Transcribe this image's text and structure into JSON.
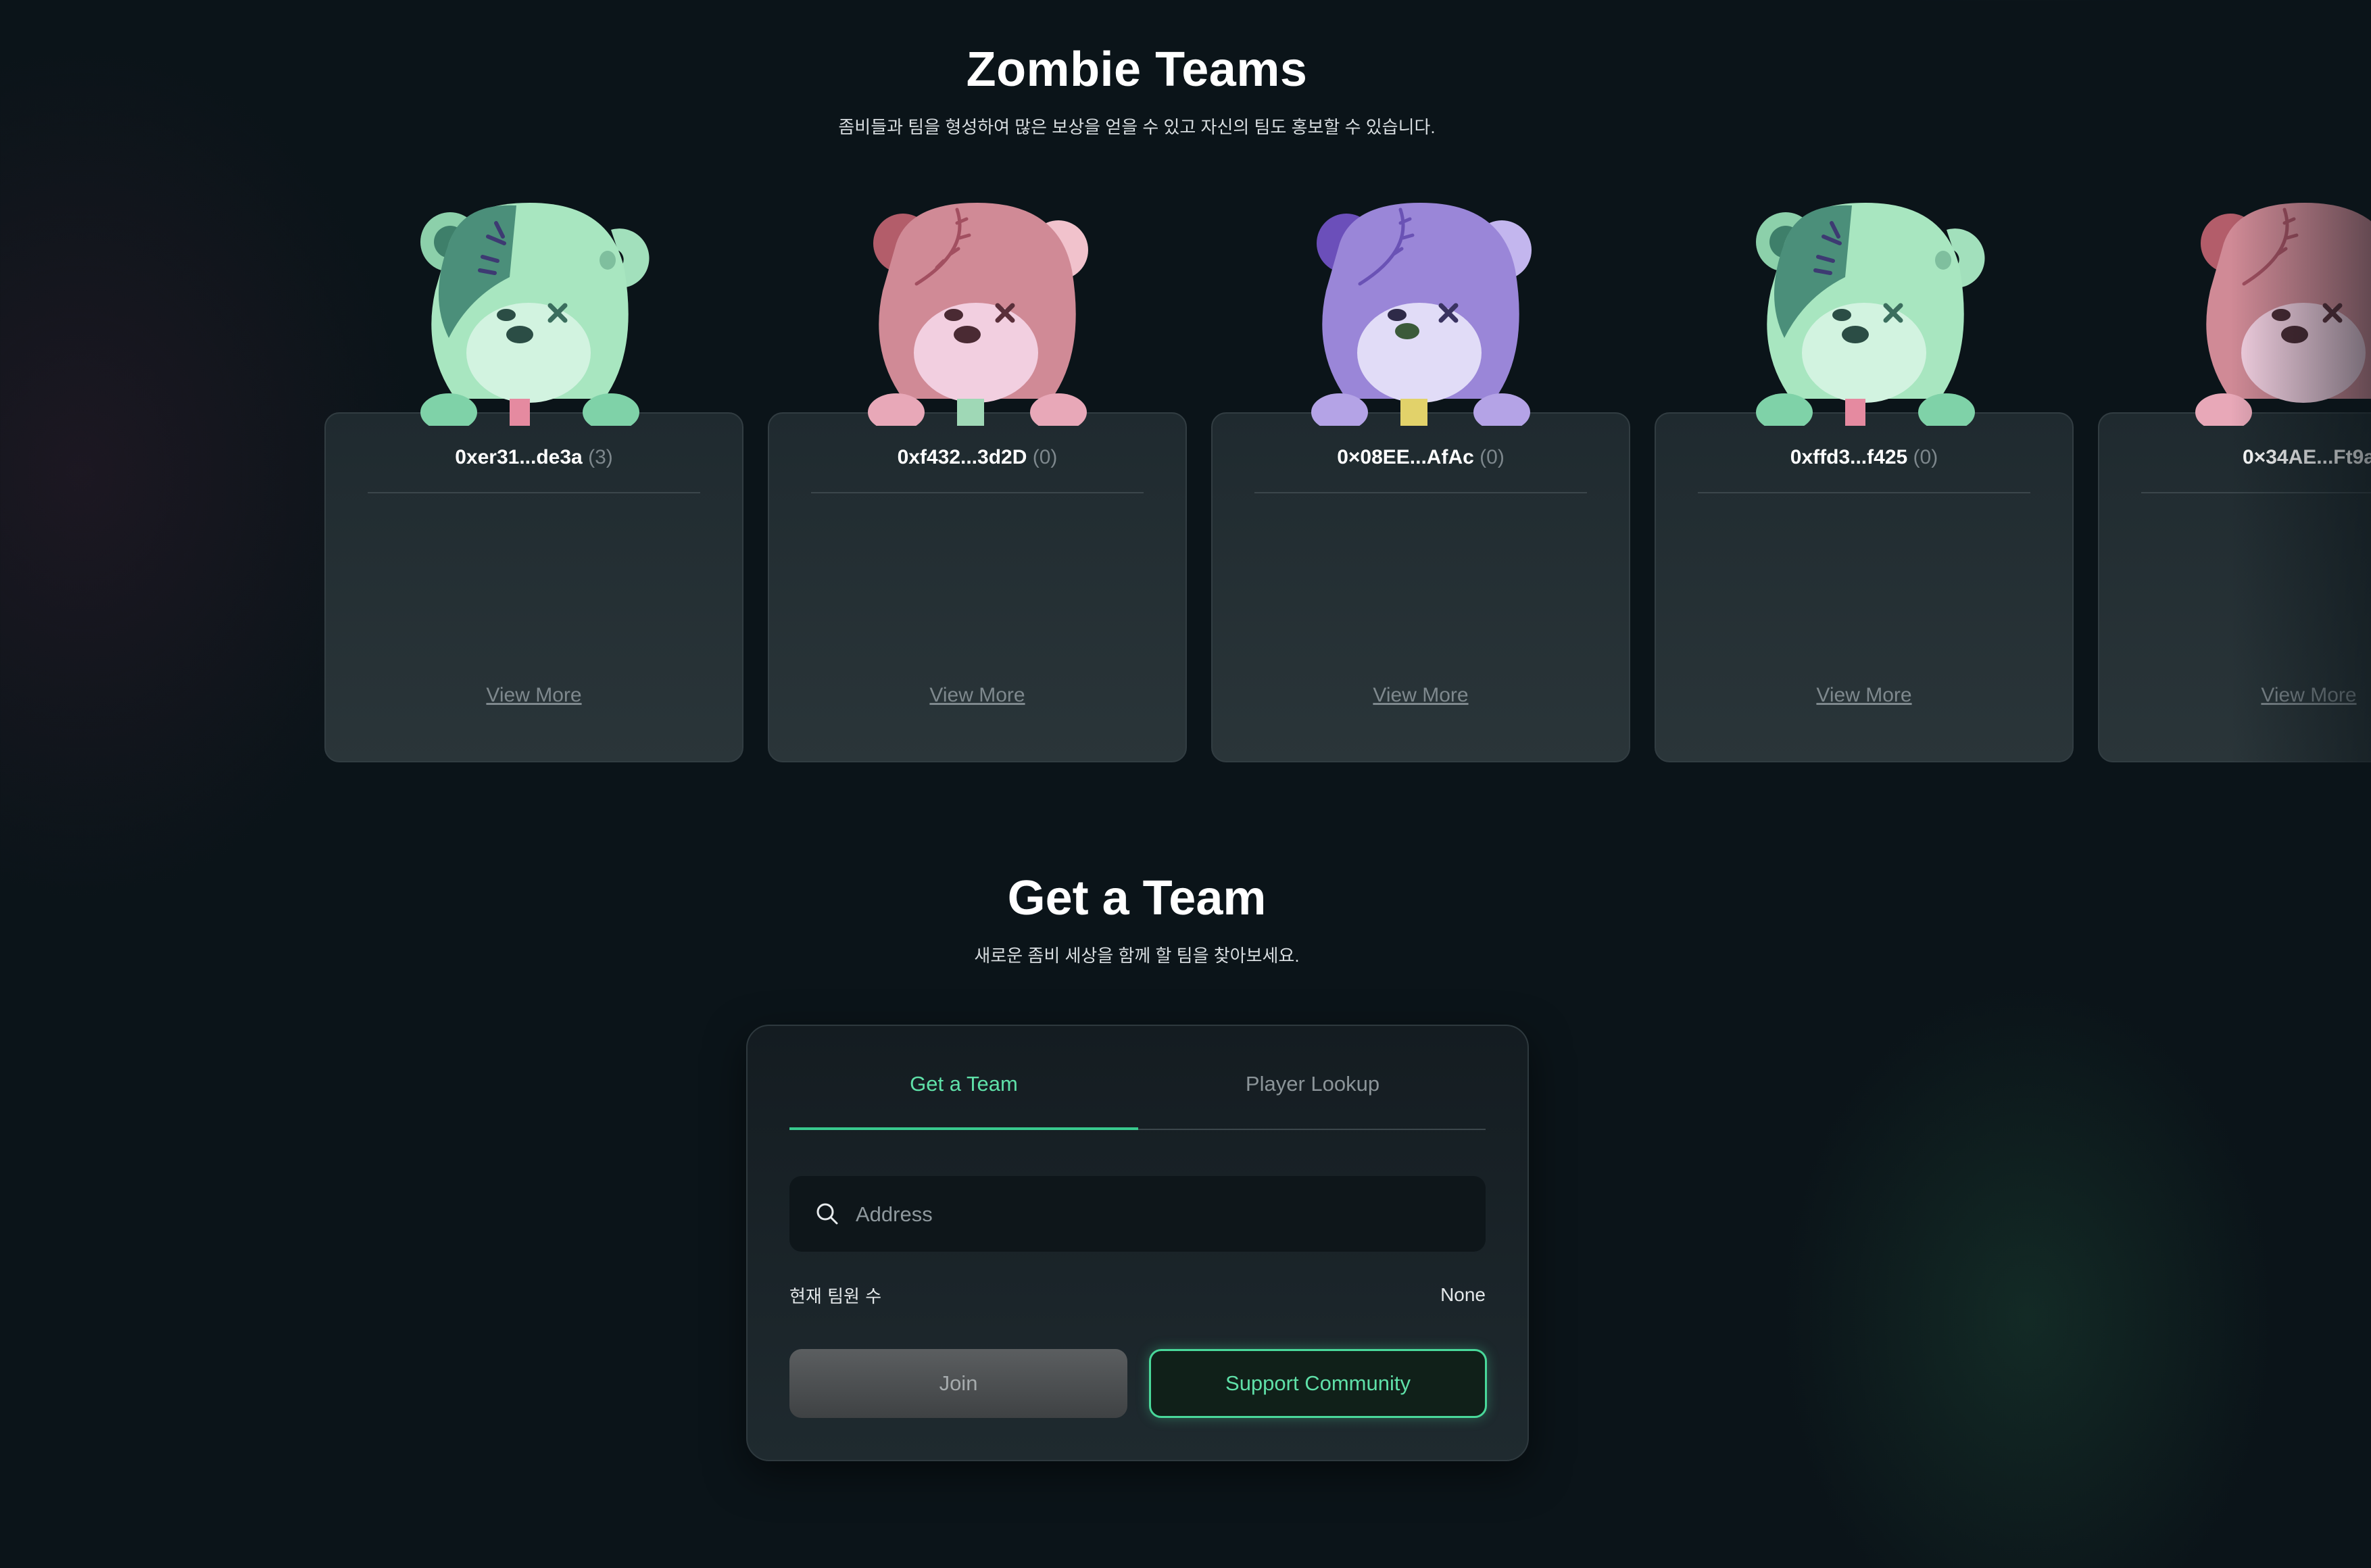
{
  "header": {
    "title": "Zombie Teams",
    "subtitle": "좀비들과 팀을 형성하여 많은 보상을 얻을 수 있고 자신의 팀도 홍보할 수 있습니다."
  },
  "teams": [
    {
      "address": "0xer31...de3a",
      "count": "(3)",
      "link": "View More",
      "bear": "green-zombie-bear"
    },
    {
      "address": "0xf432...3d2D",
      "count": "(0)",
      "link": "View More",
      "bear": "pink-zombie-bear"
    },
    {
      "address": "0×08EE...AfAc",
      "count": "(0)",
      "link": "View More",
      "bear": "purple-zombie-bear"
    },
    {
      "address": "0xffd3...f425",
      "count": "(0)",
      "link": "View More",
      "bear": "green-zombie-bear"
    },
    {
      "address": "0×34AE...Ft9a",
      "count": "",
      "link": "View More",
      "bear": "pink-zombie-bear"
    }
  ],
  "get_team": {
    "title": "Get a Team",
    "subtitle": "새로운 좀비 세상을 함께 할 팀을 찾아보세요.",
    "tabs": [
      {
        "label": "Get a Team",
        "active": true
      },
      {
        "label": "Player Lookup",
        "active": false
      }
    ],
    "search": {
      "placeholder": "Address",
      "value": ""
    },
    "member_count_label": "현재 팀원 수",
    "member_count_value": "None",
    "join_label": "Join",
    "support_label": "Support Community"
  },
  "colors": {
    "background": "#0b1419",
    "accent": "#49d89a",
    "bear_green": "#a8e6c0",
    "bear_pink": "#d08a96",
    "bear_purple": "#9a86d8"
  }
}
